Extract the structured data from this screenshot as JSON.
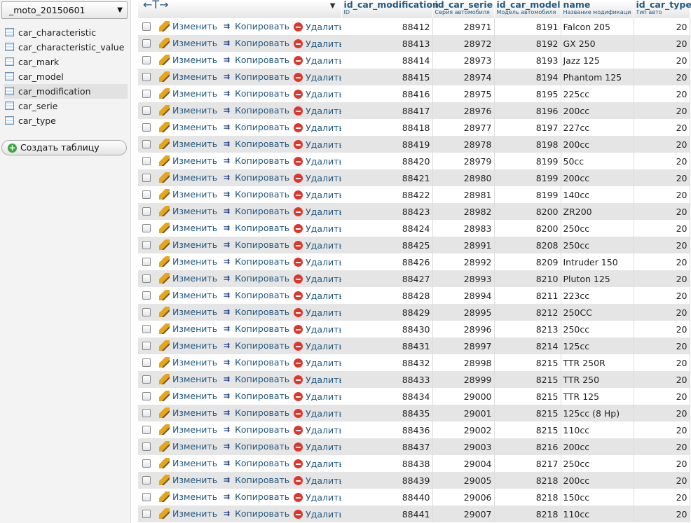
{
  "sidebar": {
    "database": "_moto_20150601",
    "tables": [
      {
        "label": "car_characteristic",
        "active": false
      },
      {
        "label": "car_characteristic_value",
        "active": false
      },
      {
        "label": "car_mark",
        "active": false
      },
      {
        "label": "car_model",
        "active": false
      },
      {
        "label": "car_modification",
        "active": true
      },
      {
        "label": "car_serie",
        "active": false
      },
      {
        "label": "car_type",
        "active": false
      }
    ],
    "create_table": "Создать таблицу"
  },
  "grid": {
    "nav_arrows": "←T→",
    "columns": [
      {
        "name": "id_car_modification",
        "comment": "ID"
      },
      {
        "name": "id_car_serie",
        "comment": "Серия автомобиля"
      },
      {
        "name": "id_car_model",
        "comment": "Модель автомобиля"
      },
      {
        "name": "name",
        "comment": "Название модификации"
      },
      {
        "name": "id_car_type",
        "comment": "Тип авто"
      }
    ],
    "actions": {
      "edit": "Изменить",
      "copy": "Копировать",
      "delete": "Удалить"
    },
    "rows": [
      [
        "88412",
        "28971",
        "8191",
        "Falcon 205",
        "20"
      ],
      [
        "88413",
        "28972",
        "8192",
        "GX 250",
        "20"
      ],
      [
        "88414",
        "28973",
        "8193",
        "Jazz 125",
        "20"
      ],
      [
        "88415",
        "28974",
        "8194",
        "Phantom 125",
        "20"
      ],
      [
        "88416",
        "28975",
        "8195",
        "225cc",
        "20"
      ],
      [
        "88417",
        "28976",
        "8196",
        "200cc",
        "20"
      ],
      [
        "88418",
        "28977",
        "8197",
        "227cc",
        "20"
      ],
      [
        "88419",
        "28978",
        "8198",
        "200cc",
        "20"
      ],
      [
        "88420",
        "28979",
        "8199",
        "50cc",
        "20"
      ],
      [
        "88421",
        "28980",
        "8199",
        "200cc",
        "20"
      ],
      [
        "88422",
        "28981",
        "8199",
        "140cc",
        "20"
      ],
      [
        "88423",
        "28982",
        "8200",
        "ZR200",
        "20"
      ],
      [
        "88424",
        "28983",
        "8200",
        "250cc",
        "20"
      ],
      [
        "88425",
        "28991",
        "8208",
        "250cc",
        "20"
      ],
      [
        "88426",
        "28992",
        "8209",
        "Intruder 150",
        "20"
      ],
      [
        "88427",
        "28993",
        "8210",
        "Pluton 125",
        "20"
      ],
      [
        "88428",
        "28994",
        "8211",
        "223cc",
        "20"
      ],
      [
        "88429",
        "28995",
        "8212",
        "250CC",
        "20"
      ],
      [
        "88430",
        "28996",
        "8213",
        "250cc",
        "20"
      ],
      [
        "88431",
        "28997",
        "8214",
        "125cc",
        "20"
      ],
      [
        "88432",
        "28998",
        "8215",
        "TTR 250R",
        "20"
      ],
      [
        "88433",
        "28999",
        "8215",
        "TTR 250",
        "20"
      ],
      [
        "88434",
        "29000",
        "8215",
        "TTR 125",
        "20"
      ],
      [
        "88435",
        "29001",
        "8215",
        "125cc (8 Hp)",
        "20"
      ],
      [
        "88436",
        "29002",
        "8215",
        "110cc",
        "20"
      ],
      [
        "88437",
        "29003",
        "8216",
        "200cc",
        "20"
      ],
      [
        "88438",
        "29004",
        "8217",
        "250cc",
        "20"
      ],
      [
        "88439",
        "29005",
        "8218",
        "200cc",
        "20"
      ],
      [
        "88440",
        "29006",
        "8218",
        "150cc",
        "20"
      ],
      [
        "88441",
        "29007",
        "8218",
        "110cc",
        "20"
      ]
    ]
  }
}
